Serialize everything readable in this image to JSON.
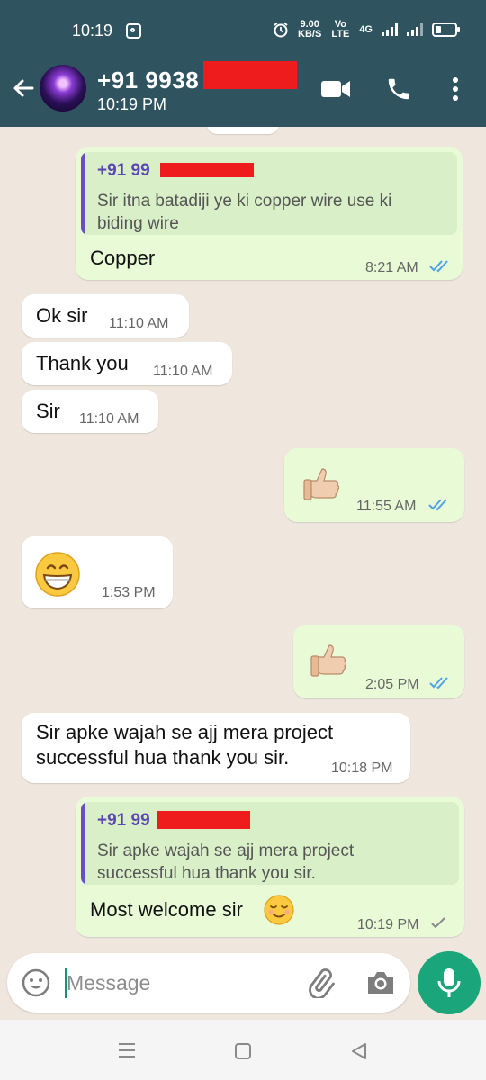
{
  "status_bar": {
    "time": "10:19",
    "net_speed_value": "9.00",
    "net_speed_unit": "KB/S",
    "volte": "Vo LTE",
    "network": "4G"
  },
  "header": {
    "contact_name": "+91 9938",
    "last_seen": "10:19 PM"
  },
  "messages": [
    {
      "direction": "out",
      "quoted_name": "+91 99",
      "quoted_text": [
        "Sir itna batadiji ye ki copper wire use ki",
        "biding wire"
      ],
      "text": "Copper",
      "time": "8:21 AM",
      "status": "read"
    },
    {
      "direction": "in",
      "text": "Ok sir",
      "time": "11:10 AM"
    },
    {
      "direction": "in",
      "text": "Thank you",
      "time": "11:10 AM"
    },
    {
      "direction": "in",
      "text": "Sir",
      "time": "11:10 AM"
    },
    {
      "direction": "out",
      "emoji": "thumbs-up",
      "time": "11:55 AM",
      "status": "read"
    },
    {
      "direction": "in",
      "emoji": "grinning-face",
      "time": "1:53 PM"
    },
    {
      "direction": "out",
      "emoji": "thumbs-up",
      "time": "2:05 PM",
      "status": "read"
    },
    {
      "direction": "in",
      "text": [
        "Sir apke wajah se ajj mera project",
        "successful hua thank you sir."
      ],
      "time": "10:18 PM"
    },
    {
      "direction": "out",
      "quoted_name": "+91 99",
      "quoted_text": [
        "Sir apke wajah se ajj mera project",
        "successful hua thank you sir."
      ],
      "text": "Most welcome sir",
      "time": "10:19 PM",
      "status": "sent"
    }
  ],
  "composer": {
    "placeholder": "Message"
  },
  "colors": {
    "header": "#2f5460",
    "outgoing_bubble": "#e8fad6",
    "incoming_bubble": "#ffffff",
    "read_ticks": "#4fa3e6",
    "accent": "#1aa67a",
    "redaction": "#ee1c1c"
  },
  "icons": [
    "back-arrow-icon",
    "video-call-icon",
    "phone-icon",
    "more-options-icon",
    "emoji-icon",
    "attach-icon",
    "camera-icon",
    "mic-icon",
    "nav-menu-icon",
    "nav-home-icon",
    "nav-back-icon"
  ]
}
